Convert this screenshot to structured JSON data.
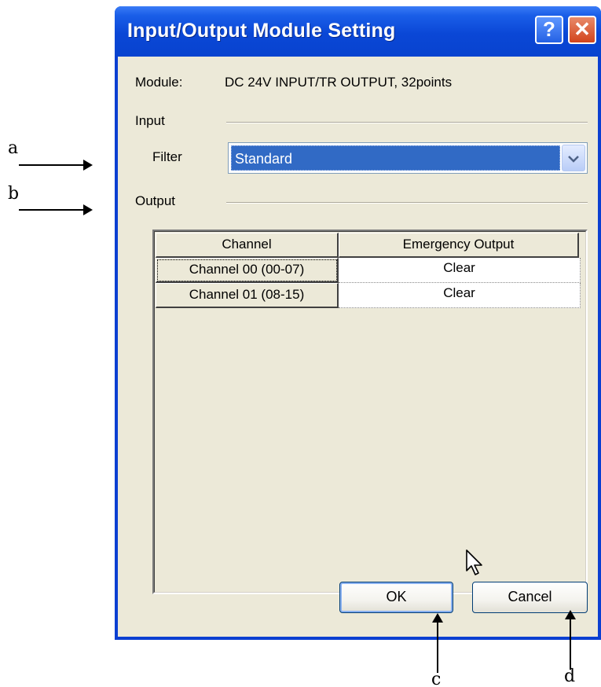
{
  "annotations": {
    "a": "a",
    "b": "b",
    "c": "c",
    "d": "d"
  },
  "dialog": {
    "title": "Input/Output Module Setting",
    "help_glyph": "?",
    "close_glyph": "✕"
  },
  "module": {
    "label": "Module:",
    "value": "DC 24V INPUT/TR OUTPUT, 32points"
  },
  "input": {
    "group_label": "Input",
    "filter_label": "Filter",
    "filter_value": "Standard"
  },
  "output": {
    "group_label": "Output",
    "columns": [
      "Channel",
      "Emergency Output"
    ],
    "rows": [
      {
        "channel": "Channel 00 (00-07)",
        "emergency_output": "Clear"
      },
      {
        "channel": "Channel 01 (08-15)",
        "emergency_output": "Clear"
      }
    ]
  },
  "buttons": {
    "ok": "OK",
    "cancel": "Cancel"
  },
  "icons": {
    "dropdown": "chevron-down-icon",
    "cursor": "mouse-pointer-icon"
  }
}
